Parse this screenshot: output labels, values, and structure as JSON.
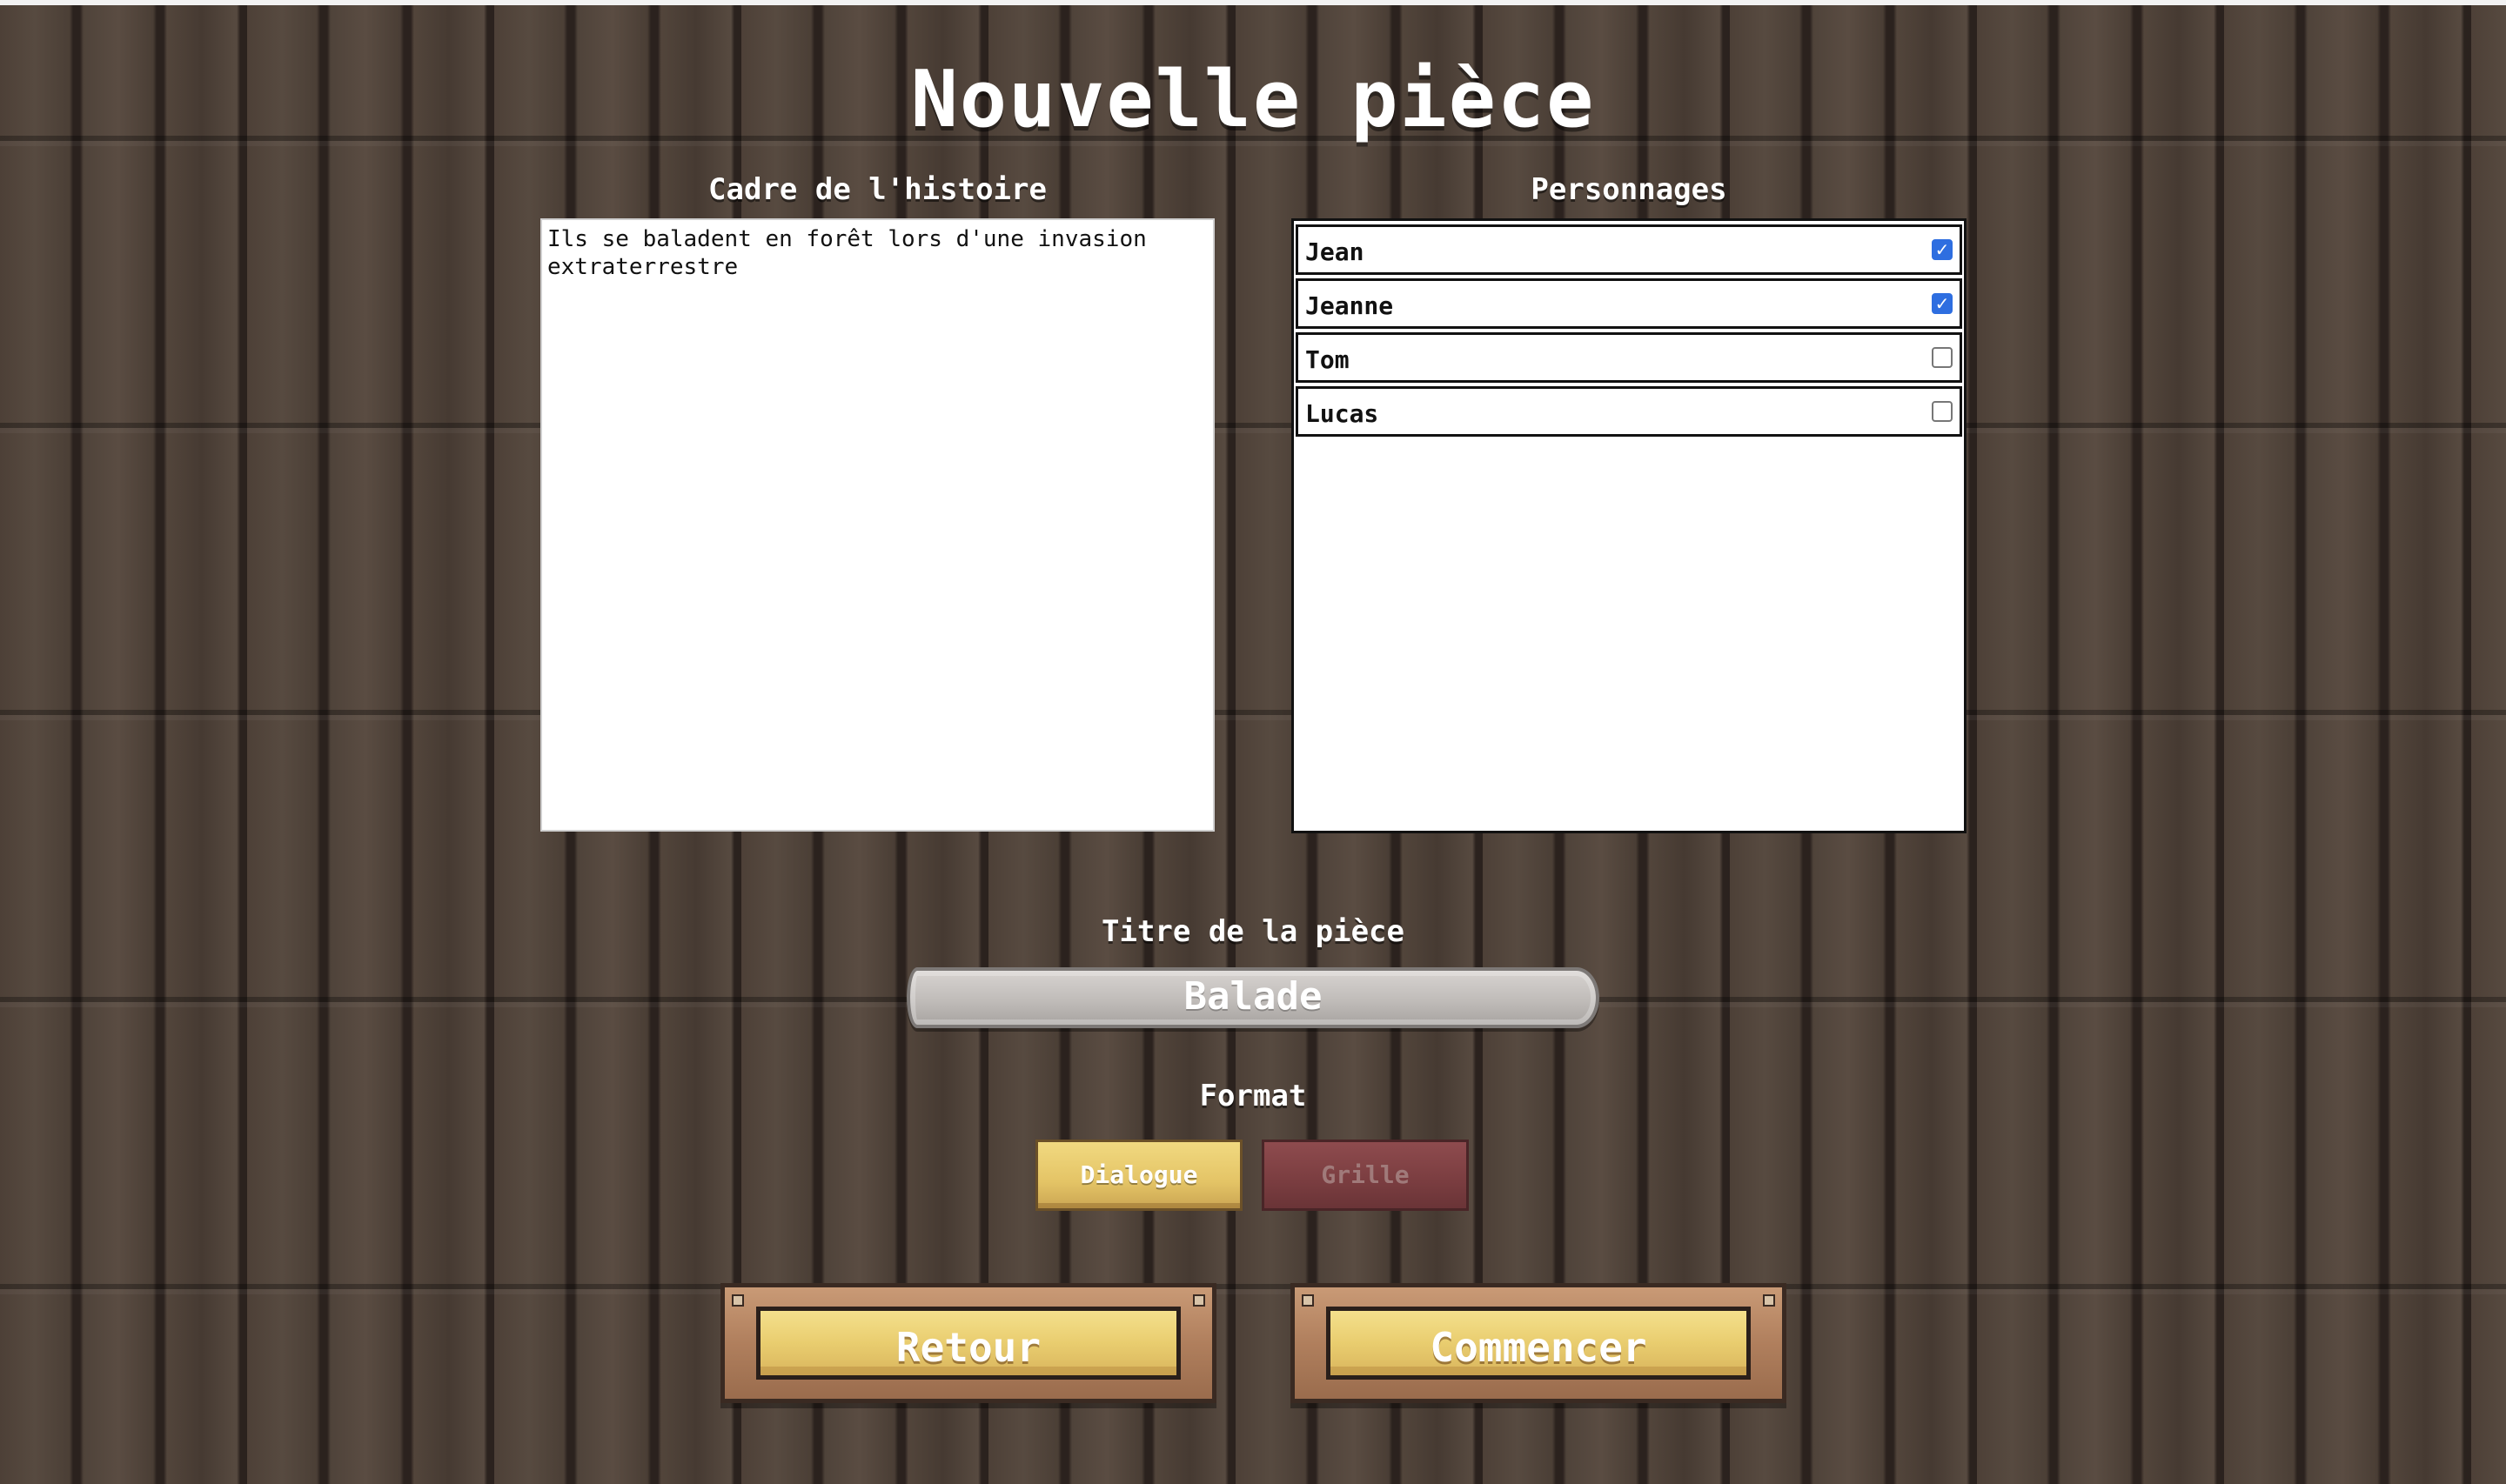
{
  "page": {
    "title": "Nouvelle pièce"
  },
  "story": {
    "label": "Cadre de l'histoire",
    "text": "Ils se baladent en forêt lors d'une invasion\nextraterrestre"
  },
  "characters": {
    "label": "Personnages",
    "items": [
      {
        "name": "Jean",
        "checked": true
      },
      {
        "name": "Jeanne",
        "checked": true
      },
      {
        "name": "Tom",
        "checked": false
      },
      {
        "name": "Lucas",
        "checked": false
      }
    ]
  },
  "play_title": {
    "label": "Titre de la pièce",
    "value": "Balade"
  },
  "format": {
    "label": "Format",
    "options": [
      {
        "label": "Dialogue",
        "selected": true
      },
      {
        "label": "Grille",
        "selected": false
      }
    ]
  },
  "actions": {
    "back_label": "Retour",
    "start_label": "Commencer"
  },
  "colors": {
    "accent": "#e9cd6f",
    "checkbox": "#2e6ee0",
    "inactive": "#7a3d40",
    "wood": "#4a3d35"
  }
}
